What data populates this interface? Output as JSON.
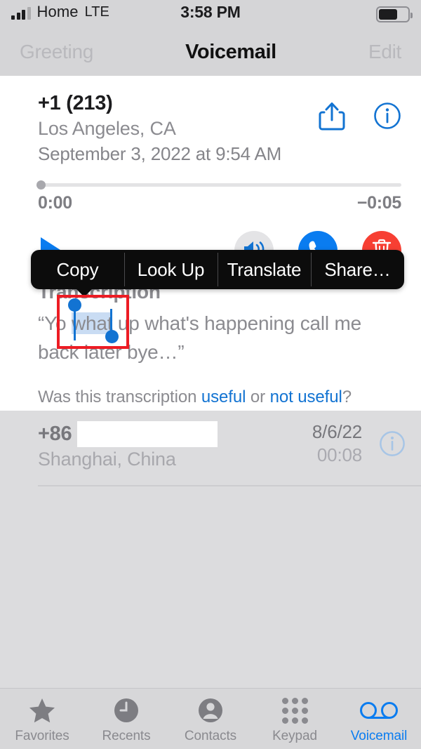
{
  "status_bar": {
    "carrier": "Home",
    "network": "LTE",
    "time": "3:58 PM",
    "signal_bars_filled": 3,
    "signal_bars_total": 4,
    "battery_level_pct": 60,
    "battery_icon": "battery-icon"
  },
  "nav_bar": {
    "left_button": "Greeting",
    "title": "Voicemail",
    "right_button": "Edit"
  },
  "selected_voicemail": {
    "number": "+1 (213)",
    "location": "Los Angeles, CA",
    "date": "September 3, 2022 at 9:54 AM",
    "share_icon": "share-icon",
    "info_icon": "info-icon",
    "player": {
      "elapsed": "0:00",
      "remaining": "−0:05",
      "progress_pct": 0
    },
    "actions": {
      "play_icon": "play-icon",
      "speaker_icon": "speaker-icon",
      "call_icon": "phone-icon",
      "delete_icon": "trash-icon"
    },
    "transcription": {
      "title": "Transcription",
      "text_before": "“Yo ",
      "text_selected": "what",
      "text_after": " up what's happening call me back later bye…”",
      "full_text": "“Yo what up what's happening call me back later bye…”",
      "feedback_prefix": "Was this transcription ",
      "feedback_link_useful": "useful",
      "feedback_middle": " or ",
      "feedback_link_not_useful": "not useful",
      "feedback_suffix": "?"
    }
  },
  "other_voicemail": {
    "number": "+86",
    "location": "Shanghai, China",
    "date": "8/6/22",
    "duration": "00:08",
    "info_icon": "info-icon",
    "redacted": true
  },
  "context_menu": {
    "items": [
      {
        "label": "Copy",
        "name": "copy"
      },
      {
        "label": "Look Up",
        "name": "look-up"
      },
      {
        "label": "Translate",
        "name": "translate"
      },
      {
        "label": "Share…",
        "name": "share"
      }
    ]
  },
  "tab_bar": {
    "items": [
      {
        "label": "Favorites",
        "icon": "star-icon",
        "active": false
      },
      {
        "label": "Recents",
        "icon": "clock-icon",
        "active": false
      },
      {
        "label": "Contacts",
        "icon": "person-icon",
        "active": false
      },
      {
        "label": "Keypad",
        "icon": "keypad-icon",
        "active": false
      },
      {
        "label": "Voicemail",
        "icon": "voicemail-icon",
        "active": true
      }
    ]
  },
  "colors": {
    "accent_blue": "#0a7cf0",
    "link_blue": "#1273d2",
    "destructive_red": "#f73f33",
    "selection_highlight": "#c9dcf3",
    "annotation_red": "#ed1c24",
    "menu_background": "#0c0c0c",
    "screen_background": "#dcdcde"
  }
}
